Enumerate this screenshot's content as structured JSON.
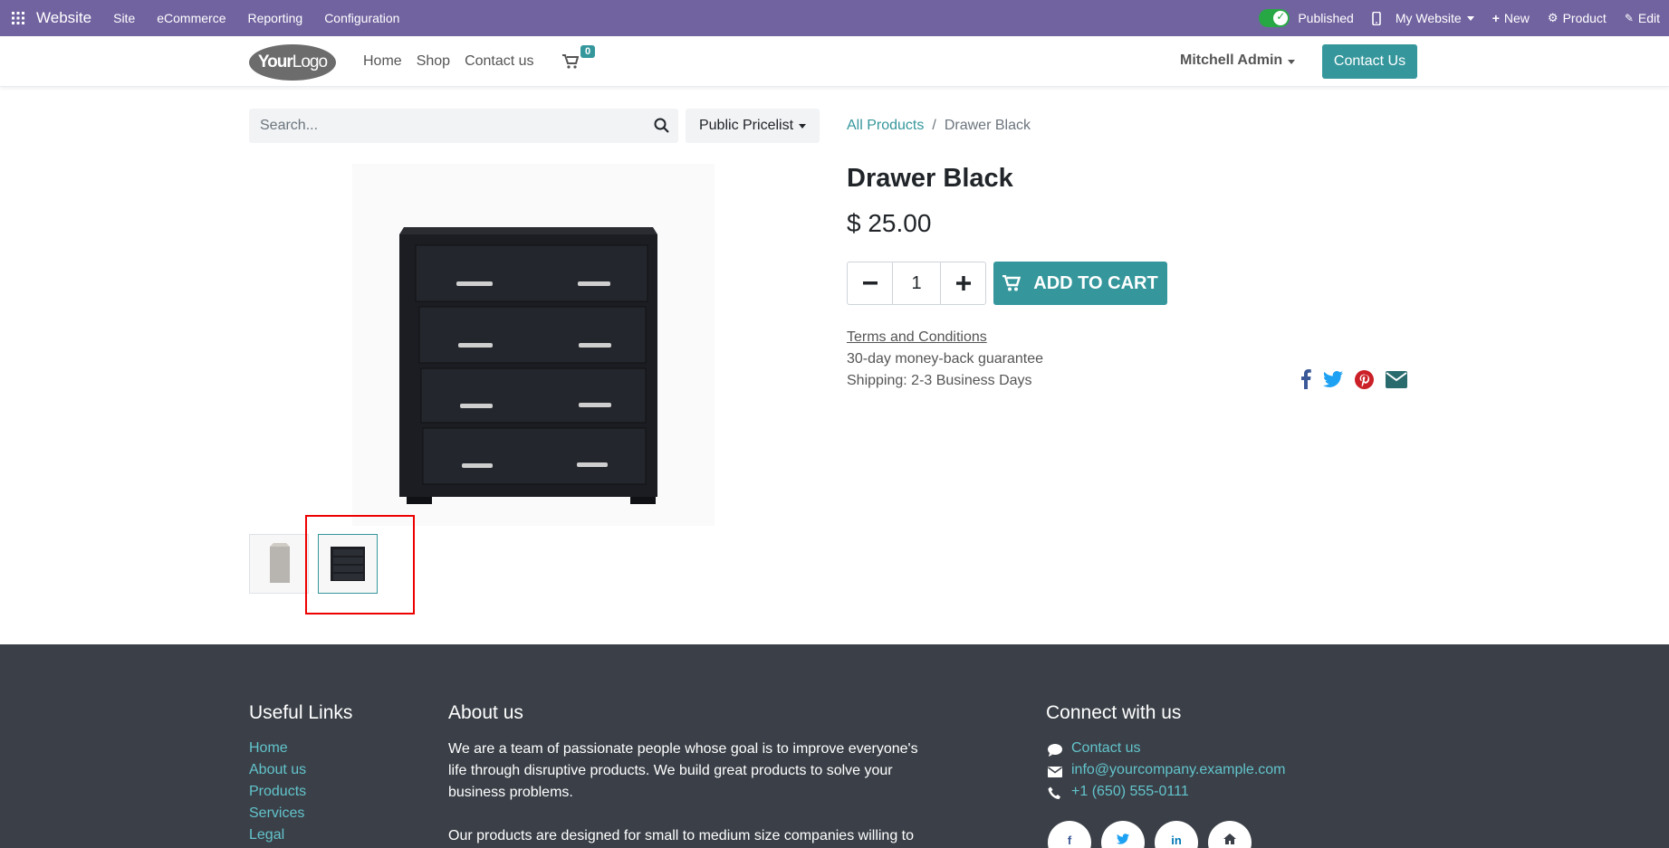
{
  "admin": {
    "app_name": "Website",
    "menus": [
      "Site",
      "eCommerce",
      "Reporting",
      "Configuration"
    ],
    "published": "Published",
    "website": "My Website",
    "new": "New",
    "product": "Product",
    "edit": "Edit"
  },
  "header": {
    "logo_a": "Your",
    "logo_b": "Logo",
    "nav": [
      "Home",
      "Shop",
      "Contact us"
    ],
    "cart_count": "0",
    "user": "Mitchell Admin",
    "contact_button": "Contact Us"
  },
  "search": {
    "placeholder": "Search...",
    "pricelist": "Public Pricelist"
  },
  "breadcrumb": {
    "parent": "All Products",
    "current": "Drawer Black"
  },
  "product": {
    "title": "Drawer Black",
    "price": "$ 25.00",
    "quantity": "1",
    "add_to_cart": "ADD TO CART",
    "terms": "Terms and Conditions",
    "guarantee": "30-day money-back guarantee",
    "shipping": "Shipping: 2-3 Business Days"
  },
  "footer": {
    "useful_links_title": "Useful Links",
    "useful_links": [
      "Home",
      "About us",
      "Products",
      "Services",
      "Legal"
    ],
    "about_title": "About us",
    "about_p1_l1": "We are a team of passionate people whose goal is to improve everyone's",
    "about_p1_l2": "life through disruptive products. We build great products to solve your",
    "about_p1_l3": "business problems.",
    "about_p2_l1": "Our products are designed for small to medium size companies willing to",
    "connect_title": "Connect with us",
    "contact": "Contact us",
    "email": "info@yourcompany.example.com",
    "phone": "+1 (650) 555-0111"
  },
  "colors": {
    "admin_bar": "#7163a0",
    "primary": "#35979c",
    "footer_bg": "#3b4048",
    "footer_link": "#62c3cb"
  },
  "icons": [
    "apps-icon",
    "check-icon",
    "mobile-icon",
    "plus-icon",
    "gear-icon",
    "pencil-icon",
    "cart-icon",
    "search-icon",
    "minus-icon",
    "facebook-icon",
    "twitter-icon",
    "pinterest-icon",
    "envelope-icon",
    "comment-icon",
    "phone-icon",
    "linkedin-icon",
    "home-icon"
  ]
}
